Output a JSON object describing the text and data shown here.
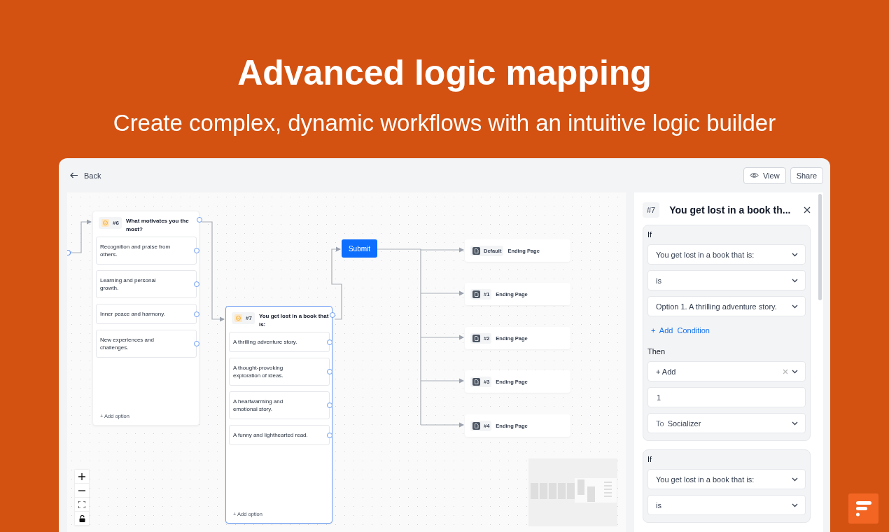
{
  "hero": {
    "title": "Advanced logic mapping",
    "subtitle": "Create complex, dynamic workflows with an intuitive logic builder"
  },
  "toolbar": {
    "back": "Back",
    "buttons": [
      {
        "label": "View",
        "kind": "eye"
      },
      {
        "label": "Share",
        "kind": "plain"
      }
    ]
  },
  "canvas": {
    "questions": [
      {
        "number": "#6",
        "title": "What motivates you the most?",
        "selected": false,
        "options": [
          "Recognition and praise from others.",
          "Learning and personal growth.",
          "Inner peace and harmony.",
          "New experiences and challenges."
        ],
        "add_option": "+ Add option"
      },
      {
        "number": "#7",
        "title": "You get lost in a book that is:",
        "selected": true,
        "options": [
          "A thrilling adventure story.",
          "A thought-provoking exploration of ideas.",
          "A heartwarming and emotional story.",
          "A funny and lighthearted read."
        ],
        "add_option": "+ Add option"
      }
    ],
    "submit": "Submit",
    "endings": [
      {
        "tag": "Default",
        "label": "Ending Page"
      },
      {
        "tag": "#1",
        "label": "Ending Page"
      },
      {
        "tag": "#2",
        "label": "Ending Page"
      },
      {
        "tag": "#3",
        "label": "Ending Page"
      },
      {
        "tag": "#4",
        "label": "Ending Page"
      }
    ]
  },
  "panel": {
    "badge": "#7",
    "title": "You get lost in a book th...",
    "rules": [
      {
        "if_label": "If",
        "conditions": [
          "You get lost in a book that is:",
          "is",
          "Option 1. A thrilling adventure story."
        ],
        "add_condition": "+ Add Condition",
        "then_label": "Then",
        "actions": [
          {
            "kind": "select",
            "value": "+ Add",
            "clearable": true
          },
          {
            "kind": "input",
            "value": "1"
          },
          {
            "kind": "select",
            "prefix": "To",
            "value": "Socializer",
            "clearable": false
          }
        ]
      },
      {
        "if_label": "If",
        "conditions": [
          "You get lost in a book that is:",
          "is"
        ]
      }
    ]
  }
}
